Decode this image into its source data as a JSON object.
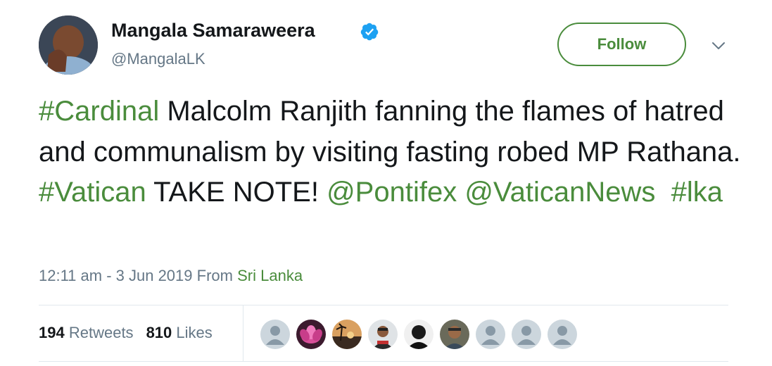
{
  "author": {
    "name": "Mangala Samaraweera",
    "handle": "@MangalaLK",
    "verified_icon": "verified-badge-icon"
  },
  "follow_label": "Follow",
  "tweet": {
    "hashtag_cardinal": "#Cardinal",
    "text_1": " Malcolm Ranjith fanning the flames of hatred and communalism by visiting fasting robed MP Rathana. ",
    "hashtag_vatican": "#Vatican",
    "text_2": " TAKE NOTE! ",
    "mention_pontifex": "@Pontifex",
    "mention_vaticannews": "@VaticanNews",
    "hashtag_lka": "#lka"
  },
  "meta": {
    "timestamp": "12:11 am - 3 Jun 2019",
    "from_label": "From",
    "location": "Sri Lanka"
  },
  "stats": {
    "retweets_count": "194",
    "retweets_label": "Retweets",
    "likes_count": "810",
    "likes_label": "Likes"
  },
  "likers": [
    "default-avatar-icon",
    "lotus-photo-avatar",
    "sunset-photo-avatar",
    "person-photo-avatar",
    "silhouette-photo-avatar",
    "man-photo-avatar",
    "default-avatar-icon",
    "default-avatar-icon",
    "default-avatar-icon"
  ],
  "colors": {
    "link": "#4a8c3c",
    "verified": "#1da1f2",
    "secondary_text": "#657786",
    "primary_text": "#14171a"
  }
}
